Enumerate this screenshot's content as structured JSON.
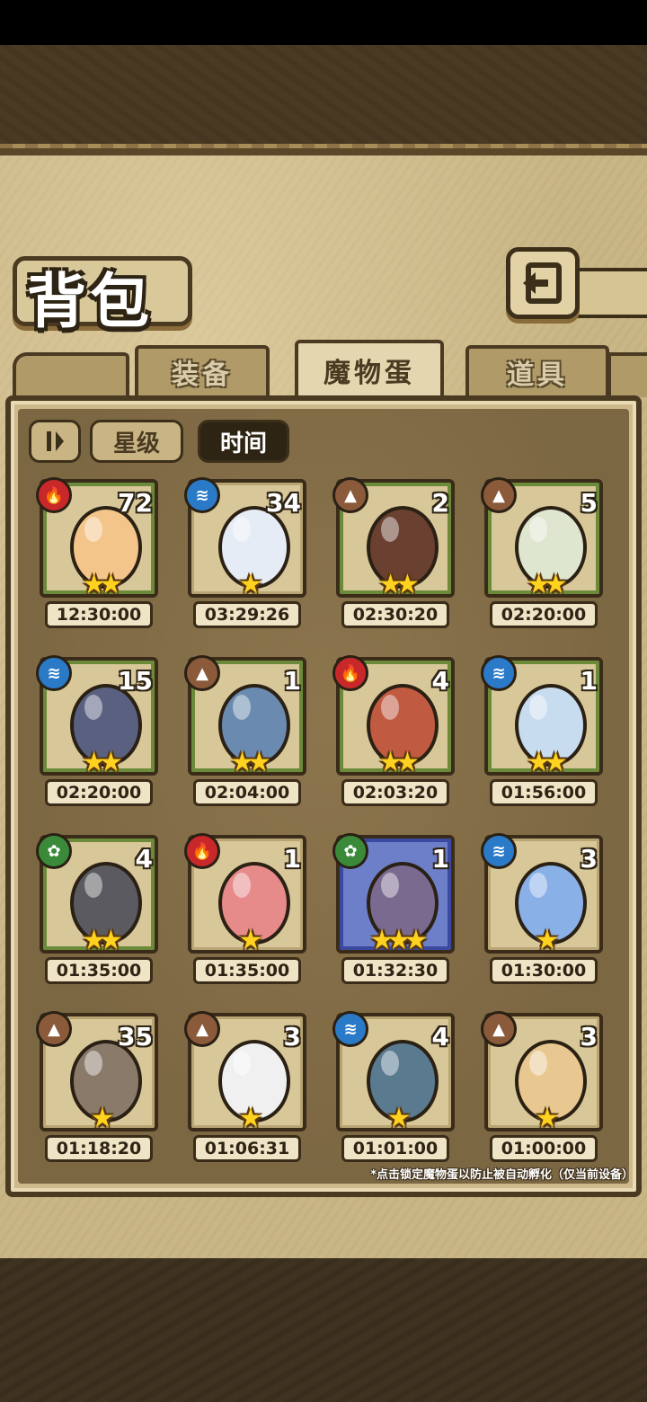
{
  "screen": {
    "title": "背包",
    "tabs": [
      {
        "label": "装备",
        "active": false
      },
      {
        "label": "魔物蛋",
        "active": true
      },
      {
        "label": "道具",
        "active": false
      }
    ],
    "sort_buttons": {
      "toggle_icon": "sort-order-icon",
      "star_label": "星级",
      "time_label": "时间",
      "active": "时间"
    },
    "footnote": "*点击锁定魔物蛋以防止被自动孵化（仅当前设备）"
  },
  "colors": {
    "fire": "#c8282a",
    "water": "#2a7ac8",
    "earth": "#8a5a3a",
    "grass": "#3a8a3a",
    "star": "#ffd21f"
  },
  "eggs": [
    {
      "element": "fire",
      "count": "72",
      "stars": 2,
      "time": "12:30:00",
      "frame": "green",
      "color": "#f3c58a"
    },
    {
      "element": "water",
      "count": "34",
      "stars": 1,
      "time": "03:29:26",
      "frame": "plain",
      "color": "#e6ecf5"
    },
    {
      "element": "earth",
      "count": "2",
      "stars": 2,
      "time": "02:30:20",
      "frame": "green",
      "color": "#6a4030"
    },
    {
      "element": "earth",
      "count": "5",
      "stars": 2,
      "time": "02:20:00",
      "frame": "green",
      "color": "#dfe6cf"
    },
    {
      "element": "water",
      "count": "15",
      "stars": 2,
      "time": "02:20:00",
      "frame": "green",
      "color": "#5a6080"
    },
    {
      "element": "earth",
      "count": "1",
      "stars": 2,
      "time": "02:04:00",
      "frame": "green",
      "color": "#6a8ab0"
    },
    {
      "element": "fire",
      "count": "4",
      "stars": 2,
      "time": "02:03:20",
      "frame": "green",
      "color": "#c05a40"
    },
    {
      "element": "water",
      "count": "1",
      "stars": 2,
      "time": "01:56:00",
      "frame": "green",
      "color": "#c8dcf0"
    },
    {
      "element": "grass",
      "count": "4",
      "stars": 2,
      "time": "01:35:00",
      "frame": "green",
      "color": "#5a5a60"
    },
    {
      "element": "fire",
      "count": "1",
      "stars": 1,
      "time": "01:35:00",
      "frame": "plain",
      "color": "#e68a8a"
    },
    {
      "element": "grass",
      "count": "1",
      "stars": 3,
      "time": "01:32:30",
      "frame": "blue",
      "color": "#7a6a90"
    },
    {
      "element": "water",
      "count": "3",
      "stars": 1,
      "time": "01:30:00",
      "frame": "plain",
      "color": "#8ab0e8"
    },
    {
      "element": "earth",
      "count": "35",
      "stars": 1,
      "time": "01:18:20",
      "frame": "plain",
      "color": "#8a7a6a"
    },
    {
      "element": "earth",
      "count": "3",
      "stars": 1,
      "time": "01:06:31",
      "frame": "plain",
      "color": "#f0f0f0"
    },
    {
      "element": "water",
      "count": "4",
      "stars": 1,
      "time": "01:01:00",
      "frame": "plain",
      "color": "#5a7a90"
    },
    {
      "element": "earth",
      "count": "3",
      "stars": 1,
      "time": "01:00:00",
      "frame": "plain",
      "color": "#e8c890"
    }
  ]
}
